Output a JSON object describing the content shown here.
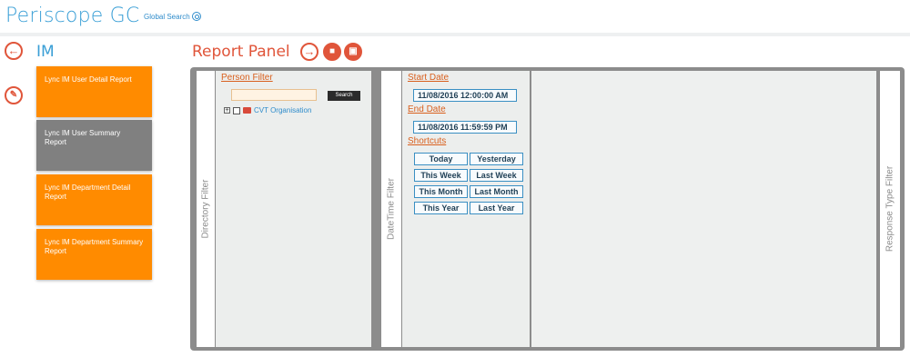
{
  "app": {
    "title": "Periscope GC",
    "global_search": "Global Search"
  },
  "left": {
    "title": "IM"
  },
  "report_cards": [
    {
      "label": "Lync IM User Detail Report",
      "active": false
    },
    {
      "label": "Lync IM User Summary Report",
      "active": true
    },
    {
      "label": "Lync IM Department Detail Report",
      "active": false
    },
    {
      "label": "Lync IM Department Summary Report",
      "active": false
    }
  ],
  "panel": {
    "title": "Report Panel"
  },
  "directory_filter": {
    "label": "Directory Filter",
    "person_filter": "Person Filter",
    "search_value": "",
    "search_button": "Search",
    "tree_root": "CVT Organisation"
  },
  "datetime_filter": {
    "label": "DateTime Filter",
    "start_label": "Start Date",
    "start_value": "11/08/2016 12:00:00 AM",
    "end_label": "End Date",
    "end_value": "11/08/2016 11:59:59 PM",
    "shortcuts_label": "Shortcuts",
    "shortcuts": [
      "Today",
      "Yesterday",
      "This Week",
      "Last Week",
      "This Month",
      "Last Month",
      "This Year",
      "Last Year"
    ]
  },
  "response_filter": {
    "label": "Response Type Filter"
  },
  "colors": {
    "brand": "#3a9fd6",
    "accent": "#e0553a",
    "card": "#ff8b00",
    "card_active": "#808080"
  }
}
